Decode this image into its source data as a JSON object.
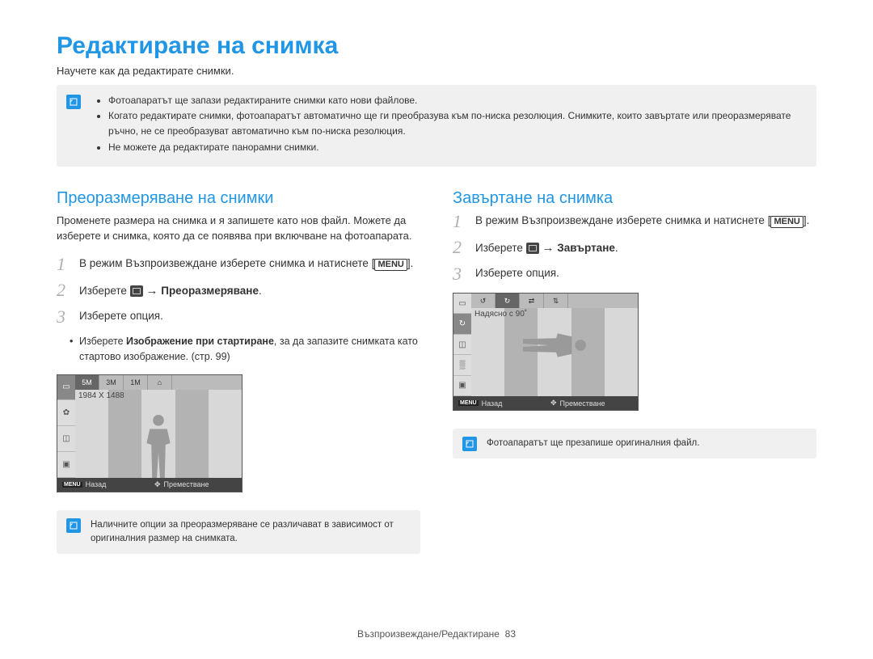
{
  "pageTitle": "Редактиране на снимка",
  "intro": "Научете как да редактирате снимки.",
  "topNotes": [
    "Фотоапаратът ще запази редактираните снимки като нови файлове.",
    "Когато редактирате снимки, фотоапаратът автоматично ще ги преобразува към по-ниска резолюция. Снимките, които завъртате или преоразмерявате ръчно, не се преобразуват автоматично към по-ниска резолюция.",
    "Не можете да редактирате панорамни снимки."
  ],
  "left": {
    "sectionTitle": "Преоразмеряване на снимки",
    "desc": "Променете размера на снимка и я запишете като нов файл. Можете да изберете и снимка, която да се появява при включване на фотоапарата.",
    "step1_a": "В режим Възпроизвеждане изберете снимка и натиснете ",
    "step1_menu": "MENU",
    "step1_b": ".",
    "step2_a": "Изберете ",
    "step2_arrow": "→",
    "step2_bold": "Преоразмеряване",
    "step2_b": ".",
    "step3": "Изберете опция.",
    "bullet_a": "Изберете ",
    "bullet_bold": "Изображение при стартиране",
    "bullet_b": ", за да запазите снимката като стартово изображение. (стр. 99)",
    "lcd": {
      "readout": "1984 X 1488",
      "footer_back": "Назад",
      "footer_move": "Преместване",
      "footer_menu": "MENU",
      "top_labels": [
        "5M",
        "3M",
        "1M",
        "⌂"
      ]
    },
    "note": "Наличните опции за преоразмеряване се различават в зависимост от оригиналния размер на снимката."
  },
  "right": {
    "sectionTitle": "Завъртане на снимка",
    "step1_a": "В режим Възпроизвеждане изберете снимка и натиснете ",
    "step1_menu": "MENU",
    "step1_b": ".",
    "step2_a": "Изберете ",
    "step2_arrow": "→",
    "step2_bold": "Завъртане",
    "step2_b": ".",
    "step3": "Изберете опция.",
    "lcd": {
      "readout": "Надясно с 90˚",
      "footer_back": "Назад",
      "footer_move": "Преместване",
      "footer_menu": "MENU",
      "top_labels": [
        "↺",
        "↻",
        "⇄",
        "⇅"
      ]
    },
    "note": "Фотоапаратът ще презапише оригиналния файл."
  },
  "footer": {
    "text": "Възпроизвеждане/Редактиране",
    "page": "83"
  }
}
